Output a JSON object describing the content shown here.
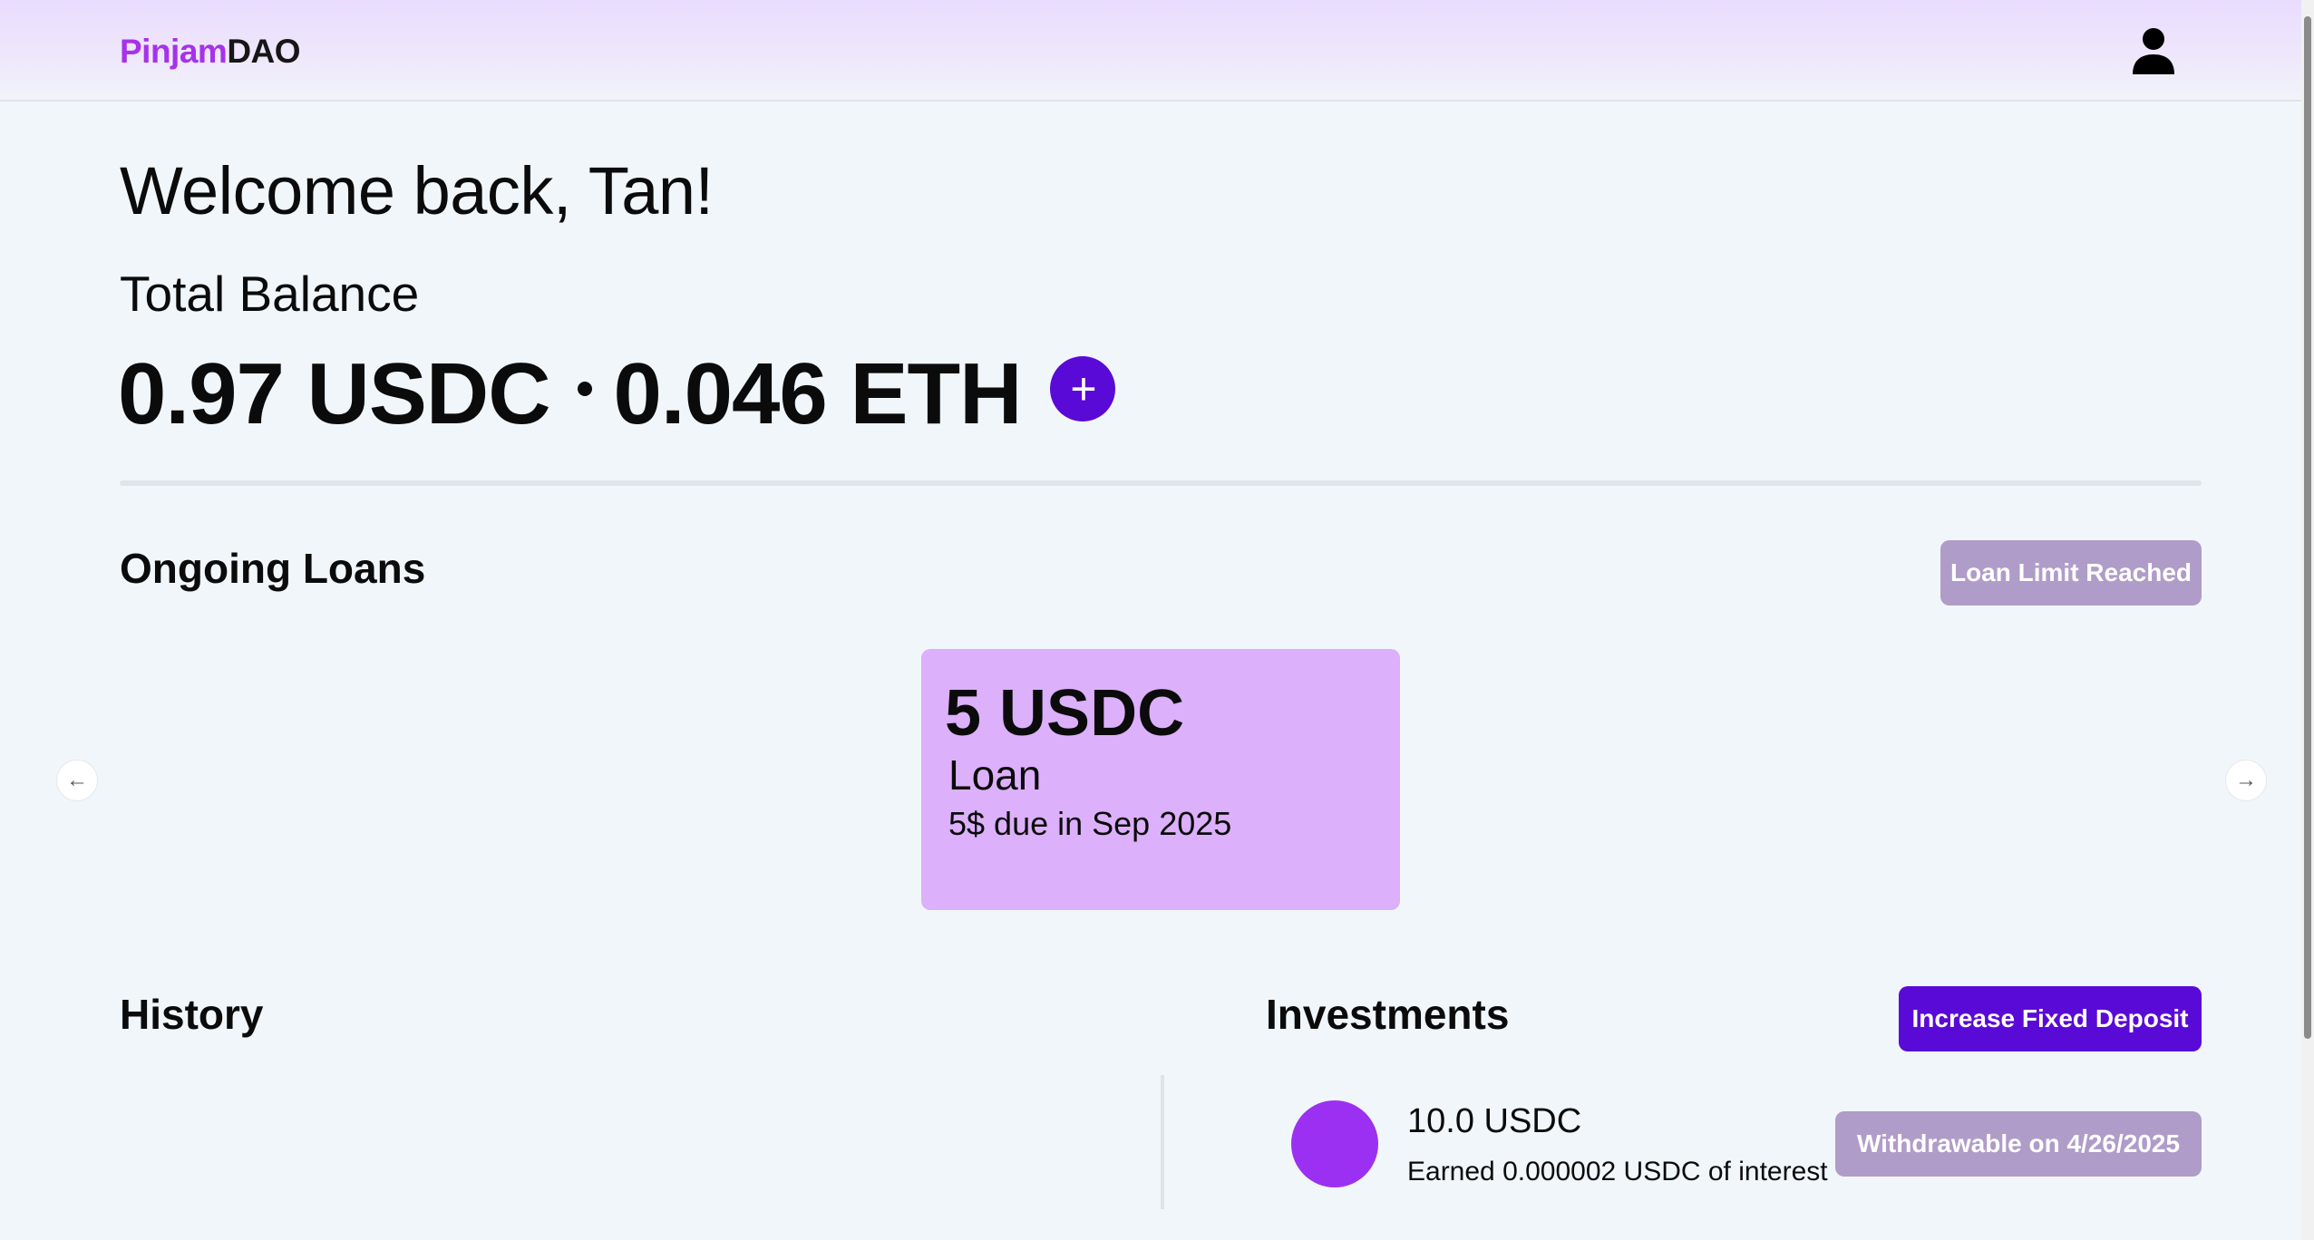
{
  "header": {
    "logo_part1": "Pinjam",
    "logo_part2": "DAO",
    "profile_icon": "user-icon"
  },
  "welcome": {
    "greeting": "Welcome back, Tan!",
    "total_balance_label": "Total Balance",
    "usdc_balance": "0.97 USDC",
    "eth_balance": "0.046 ETH",
    "add_label": "+"
  },
  "loans": {
    "title": "Ongoing Loans",
    "limit_button": "Loan Limit Reached",
    "prev_arrow": "←",
    "next_arrow": "→",
    "items": [
      {
        "amount": "5 USDC",
        "type": "Loan",
        "due": "5$ due in Sep 2025"
      }
    ]
  },
  "history": {
    "title": "History"
  },
  "investments": {
    "title": "Investments",
    "increase_button": "Increase Fixed Deposit",
    "items": [
      {
        "amount": "10.0 USDC",
        "interest": "Earned 0.000002 USDC of interest",
        "withdraw_label": "Withdrawable on 4/26/2025"
      }
    ]
  },
  "colors": {
    "accent": "#5a0ad6",
    "brand": "#a632ea",
    "loan_card": "#dcb0fb",
    "disabled_button": "#b09cc8",
    "investment_circle": "#9b30f2"
  }
}
